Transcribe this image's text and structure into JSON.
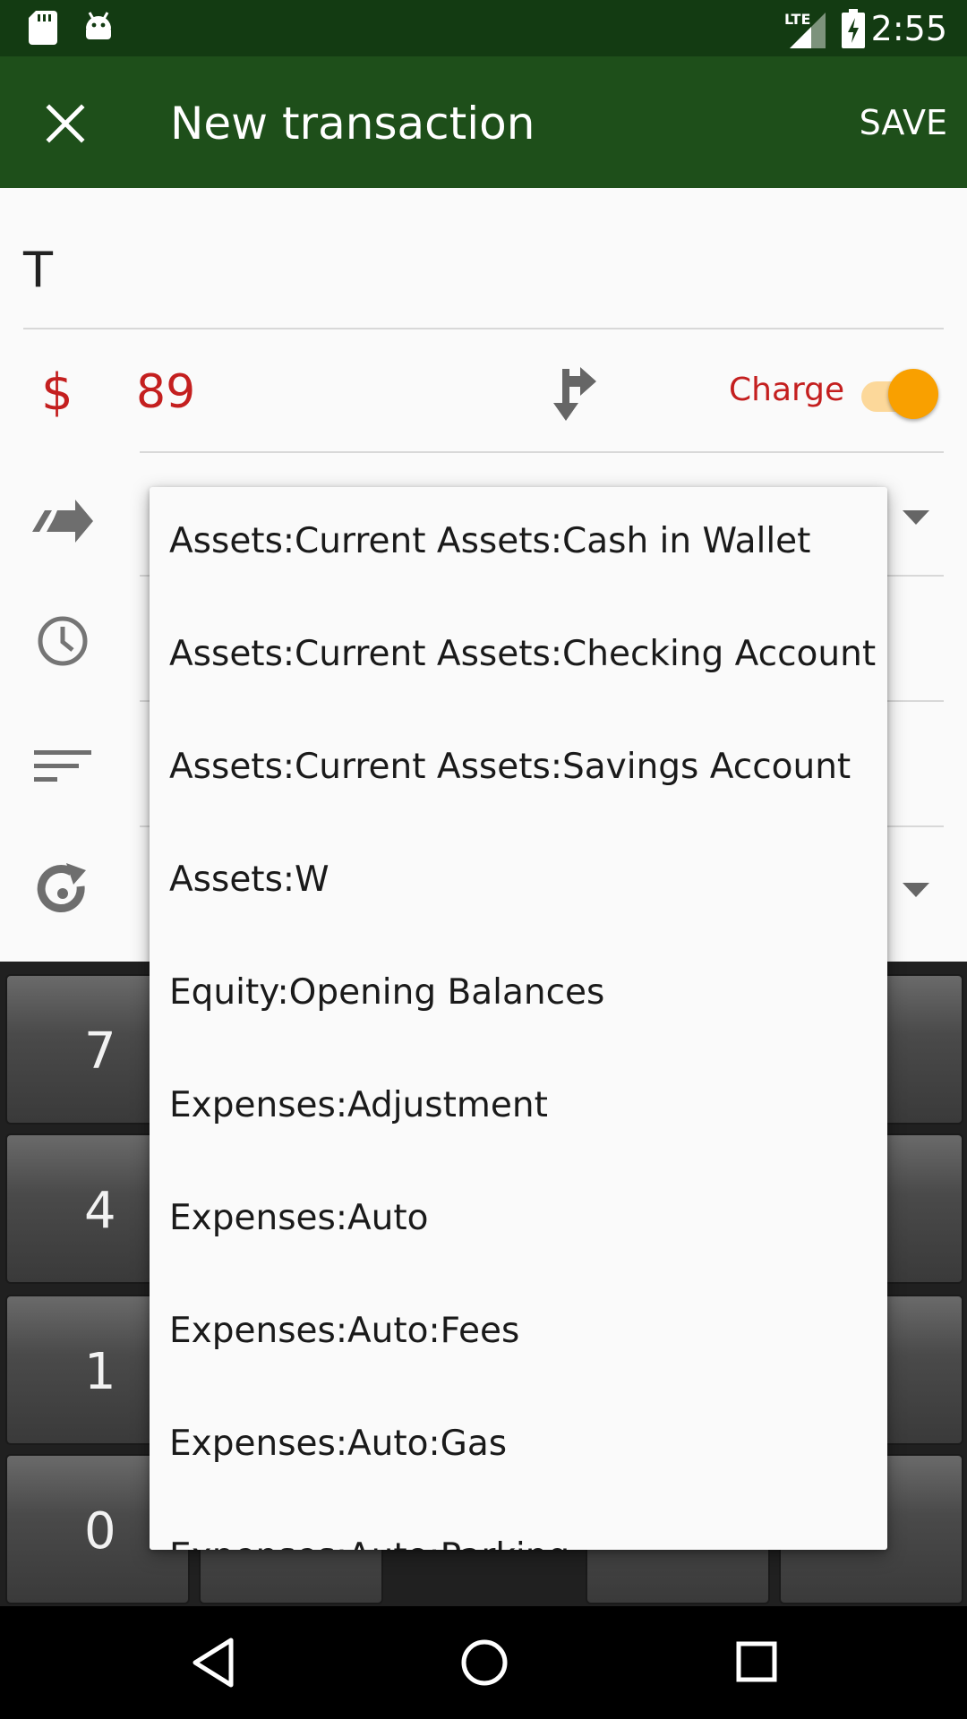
{
  "status_bar": {
    "time": "2:55",
    "network": "LTE",
    "icons": [
      "sd-card-icon",
      "android-icon",
      "signal-icon",
      "battery-charging-icon"
    ]
  },
  "toolbar": {
    "title": "New transaction",
    "save_label": "SAVE",
    "close_icon": "close-icon"
  },
  "form": {
    "description_value": "T",
    "currency_symbol": "$",
    "amount_value": "89",
    "charge_label": "Charge",
    "charge_toggle_on": true,
    "icons": [
      "transfer-arrow-icon",
      "clock-icon",
      "notes-icon",
      "recurrence-icon",
      "split-icon"
    ]
  },
  "keypad": {
    "visible_keys": [
      "7",
      "4",
      "1",
      "0"
    ]
  },
  "account_dropdown": {
    "items": [
      "Assets:Current Assets:Cash in Wallet",
      "Assets:Current Assets:Checking Account",
      "Assets:Current Assets:Savings Account",
      "Assets:W",
      "Equity:Opening Balances",
      "Expenses:Adjustment",
      "Expenses:Auto",
      "Expenses:Auto:Fees",
      "Expenses:Auto:Gas",
      "Expenses:Auto:Parking"
    ]
  },
  "colors": {
    "status_bar": "#133b12",
    "toolbar": "#1e4f1a",
    "amount_red": "#c41f1f",
    "toggle_thumb": "#f9a000",
    "toggle_track": "#fcd89a"
  }
}
